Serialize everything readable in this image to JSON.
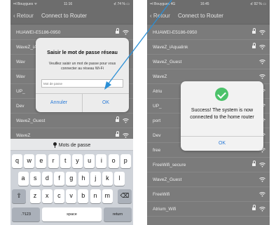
{
  "left": {
    "status": {
      "carrier": "••l Bouygues ᯤ",
      "time": "11:16",
      "battery": "⊀ 74 % ▭"
    },
    "nav": {
      "back": "‹ Retour",
      "title": "Connect to Router"
    },
    "rows": [
      {
        "name": "HUAWEI-E5186-0950",
        "locked": true
      },
      {
        "name": "WaveZ_iAqualink",
        "locked": true
      },
      {
        "name": "Wav",
        "locked": true
      },
      {
        "name": "Wav",
        "locked": true
      },
      {
        "name": "UP_",
        "locked": true
      },
      {
        "name": "Dev",
        "locked": true
      },
      {
        "name": "WaveZ_Guest",
        "locked": true
      },
      {
        "name": "WaveZ",
        "locked": true
      }
    ],
    "dialog": {
      "title": "Saisir le mot de passe réseau",
      "message": "Veuillez saisir un mot de passe pour vous connecter au réseau Wi-Fi",
      "placeholder": "Mot de passe",
      "cancel": "Annuler",
      "ok": "OK"
    },
    "keyboard": {
      "bar_label": "Mots de passe",
      "row1": [
        "q",
        "w",
        "e",
        "r",
        "t",
        "y",
        "u",
        "i",
        "o",
        "p"
      ],
      "row2": [
        "a",
        "s",
        "d",
        "f",
        "g",
        "h",
        "j",
        "k",
        "l"
      ],
      "shift": "⇧",
      "row3": [
        "z",
        "x",
        "c",
        "v",
        "b",
        "n",
        "m"
      ],
      "delete": "⌫",
      "numbers": ".?123",
      "space": "space",
      "return": "return"
    }
  },
  "right": {
    "status": {
      "carrier": "••l Bouygues 4G",
      "time": "16:45",
      "battery": "⊀ 92 % ▭"
    },
    "nav": {
      "back": "‹ Retour",
      "title": "Connect to Router"
    },
    "rows": [
      {
        "name": "HUAWEI-E5186-0950",
        "locked": true
      },
      {
        "name": "WaveZ_iAqualink",
        "locked": true
      },
      {
        "name": "WaveZ_Guest",
        "locked": false
      },
      {
        "name": "WaveZ",
        "locked": false
      },
      {
        "name": "Atriu",
        "locked": false
      },
      {
        "name": "UP_",
        "locked": false
      },
      {
        "name": "port",
        "locked": false
      },
      {
        "name": "Dev",
        "locked": false
      },
      {
        "name": "free",
        "locked": false
      },
      {
        "name": "FreeWifi_secure",
        "locked": true
      },
      {
        "name": "WaveZ_Guest",
        "locked": false
      },
      {
        "name": "FreeWifi",
        "locked": false
      },
      {
        "name": "Atrium_Wifi",
        "locked": true
      }
    ],
    "dialog": {
      "message": "Success! The system is now connected to the home router",
      "ok": "OK"
    }
  },
  "colors": {
    "accent": "#2b7bd8",
    "success": "#4cc26a",
    "arrow": "#2a8fd6"
  }
}
